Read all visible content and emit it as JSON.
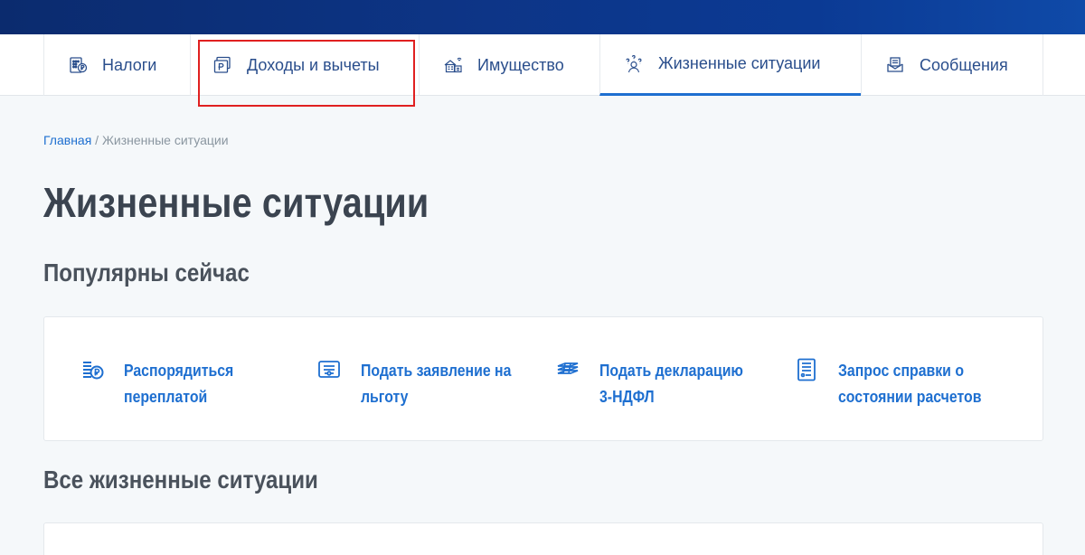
{
  "nav": {
    "items": [
      {
        "label": "Налоги",
        "icon": "calculator-ruble-icon"
      },
      {
        "label": "Доходы и вычеты",
        "icon": "ruble-documents-icon"
      },
      {
        "label": "Имущество",
        "icon": "property-house-icon"
      },
      {
        "label": "Жизненные ситуации",
        "icon": "person-questions-icon"
      },
      {
        "label": "Сообщения",
        "icon": "messages-icon"
      }
    ],
    "active_index": 3
  },
  "breadcrumb": {
    "home": "Главная",
    "separator": " / ",
    "current": "Жизненные ситуации"
  },
  "page_title": "Жизненные ситуации",
  "popular": {
    "title": "Популярны сейчас",
    "items": [
      {
        "label": "Распорядиться\nпереплатой",
        "icon": "ruble-coins-icon"
      },
      {
        "label": "Подать заявление на\nльготу",
        "icon": "application-form-icon"
      },
      {
        "label": "Подать декларацию\n3-НДФЛ",
        "icon": "declaration-stack-icon"
      },
      {
        "label": "Запрос справки о\nсостоянии расчетов",
        "icon": "certificate-list-icon"
      }
    ]
  },
  "all": {
    "title": "Все жизненные ситуации"
  },
  "colors": {
    "accent": "#1e6fd0",
    "header": "#0d3587",
    "highlight": "#e02020"
  }
}
